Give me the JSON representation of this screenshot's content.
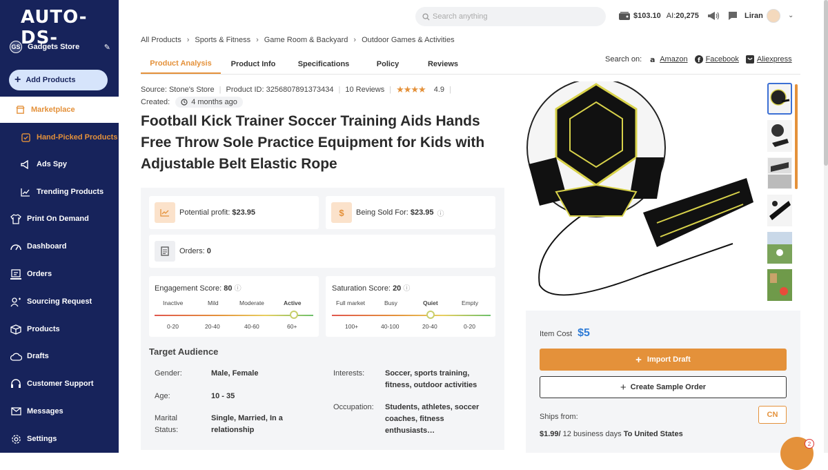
{
  "brand": {
    "logo": "AUTO-DS-"
  },
  "store": {
    "initials": "GS",
    "name": "Gadgets Store"
  },
  "sidebar": {
    "add_products": "Add Products",
    "items": [
      {
        "label": "Marketplace"
      },
      {
        "label": "Hand-Picked Products"
      },
      {
        "label": "Ads Spy"
      },
      {
        "label": "Trending Products"
      },
      {
        "label": "Print On Demand"
      },
      {
        "label": "Dashboard"
      },
      {
        "label": "Orders"
      },
      {
        "label": "Sourcing Request"
      },
      {
        "label": "Products"
      },
      {
        "label": "Drafts"
      },
      {
        "label": "Customer Support"
      },
      {
        "label": "Messages"
      },
      {
        "label": "Settings"
      }
    ]
  },
  "header": {
    "search_placeholder": "Search anything",
    "balance": "$103.10",
    "ai_label": "AI:",
    "ai_credits": "20,275",
    "user": "Liran"
  },
  "breadcrumb": [
    "All Products",
    "Sports & Fitness",
    "Game Room & Backyard",
    "Outdoor Games & Activities"
  ],
  "tabs": [
    "Product Analysis",
    "Product Info",
    "Specifications",
    "Policy",
    "Reviews"
  ],
  "search_on": {
    "label": "Search on:",
    "links": [
      "Amazon",
      "Facebook",
      "Aliexpress"
    ]
  },
  "product": {
    "source": "Source: Stone's Store",
    "product_id": "Product ID: 3256807891373434",
    "reviews": "10 Reviews",
    "rating": "4.9",
    "stars": "★★★★",
    "created_label": "Created:",
    "created_ago": "4 months ago",
    "title": "Football Kick Trainer Soccer Training Aids Hands Free Throw Sole Practice Equipment for Kids with Adjustable Belt Elastic Rope"
  },
  "analysis": {
    "potential_profit_label": "Potential profit:",
    "potential_profit": "$23.95",
    "sold_for_label": "Being Sold For:",
    "sold_for": "$23.95",
    "orders_label": "Orders:",
    "orders": "0",
    "engagement": {
      "label": "Engagement Score:",
      "value": "80",
      "levels": [
        "Inactive",
        "Mild",
        "Moderate",
        "Active"
      ],
      "ranges": [
        "0-20",
        "20-40",
        "40-60",
        "60+"
      ],
      "level_fraction": 0.88
    },
    "saturation": {
      "label": "Saturation Score:",
      "value": "20",
      "levels": [
        "Full market",
        "Busy",
        "Quiet",
        "Empty"
      ],
      "ranges": [
        "100+",
        "40-100",
        "20-40",
        "0-20"
      ],
      "level_fraction": 0.62
    }
  },
  "audience": {
    "title": "Target Audience",
    "gender_label": "Gender:",
    "gender": "Male, Female",
    "age_label": "Age:",
    "age": "10 - 35",
    "marital_label": "Marital Status:",
    "marital": "Single, Married, In a relationship",
    "interests_label": "Interests:",
    "interests": "Soccer, sports training, fitness, outdoor activities",
    "occupation_label": "Occupation:",
    "occupation": "Students, athletes, soccer coaches, fitness enthusiasts…"
  },
  "buy": {
    "item_cost_label": "Item Cost",
    "item_cost": "$5",
    "import_label": "Import Draft",
    "sample_label": "Create Sample Order",
    "ships_from_label": "Ships from:",
    "ships_from": "CN",
    "shipping_price": "$1.99/",
    "shipping_days": " 12 business days ",
    "shipping_to": "To United States"
  },
  "chat_badge": "2",
  "colors": {
    "sidebar": "#17235b",
    "accent": "#e4913a",
    "link": "#2e7bd6"
  }
}
